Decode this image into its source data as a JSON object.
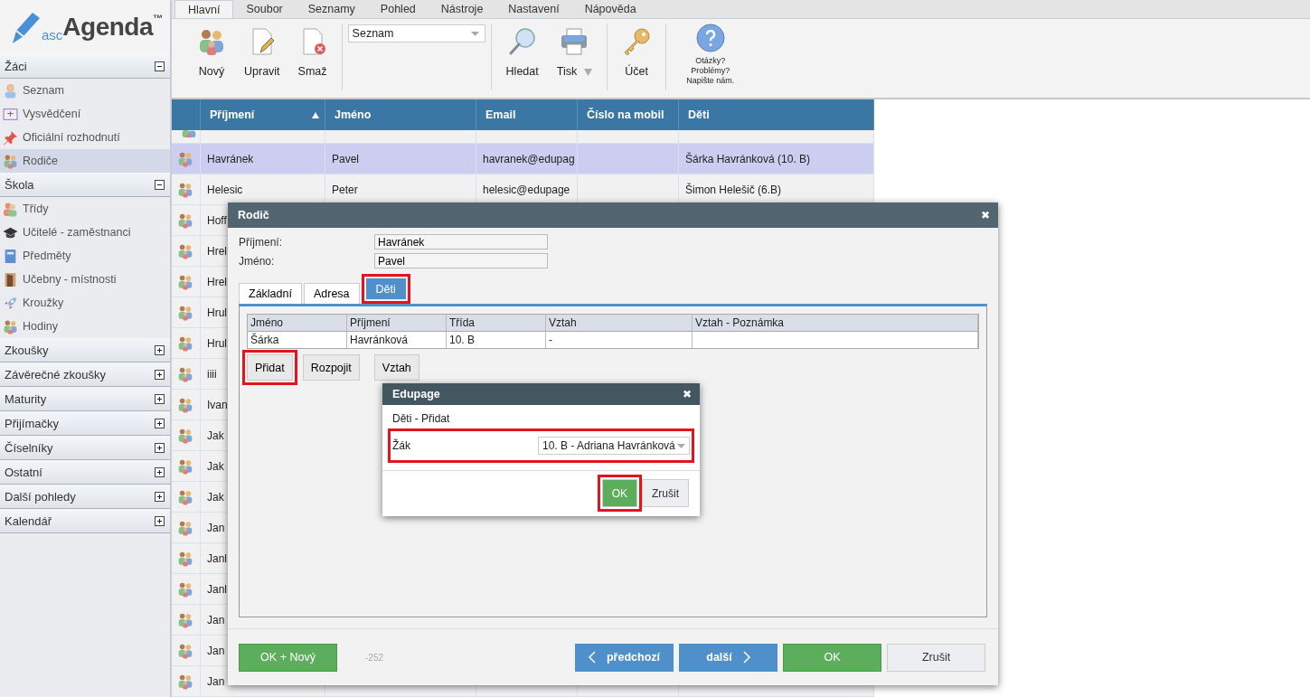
{
  "logo": {
    "prefix": "asc",
    "name": "Agenda",
    "mark": "™"
  },
  "menu_tabs": [
    {
      "label": "Hlavní",
      "selected": true
    },
    {
      "label": "Soubor",
      "selected": false
    },
    {
      "label": "Seznamy",
      "selected": false
    },
    {
      "label": "Pohled",
      "selected": false
    },
    {
      "label": "Nástroje",
      "selected": false
    },
    {
      "label": "Nastavení",
      "selected": false
    },
    {
      "label": "Nápověda",
      "selected": false
    }
  ],
  "ribbon": {
    "buttons_left": [
      {
        "label": "Nový",
        "kind": "people"
      },
      {
        "label": "Upravit",
        "kind": "edit"
      },
      {
        "label": "Smaž",
        "kind": "delete"
      }
    ],
    "view_select": {
      "value": "Seznam"
    },
    "buttons_right": [
      {
        "label": "Hledat",
        "kind": "search",
        "dropdown": false
      },
      {
        "label": "Tisk",
        "kind": "print",
        "dropdown": true
      }
    ],
    "account": {
      "label": "Účet",
      "kind": "key"
    },
    "help": {
      "lines": [
        "Otázky?",
        "Problémy?",
        "Napište nám."
      ]
    }
  },
  "sidebar": {
    "sections": [
      {
        "label": "Žáci",
        "expanded": true,
        "children": [
          {
            "label": "Seznam",
            "selected": false
          },
          {
            "label": "Vysvědčení",
            "selected": false
          },
          {
            "label": "Oficiální rozhodnutí",
            "selected": false
          },
          {
            "label": "Rodiče",
            "selected": true
          }
        ]
      },
      {
        "label": "Škola",
        "expanded": true,
        "children": [
          {
            "label": "Třídy",
            "selected": false
          },
          {
            "label": "Učitelé - zaměstnanci",
            "selected": false
          },
          {
            "label": "Předměty",
            "selected": false
          },
          {
            "label": "Učebny - místnosti",
            "selected": false
          },
          {
            "label": "Kroužky",
            "selected": false
          },
          {
            "label": "Hodiny",
            "selected": false
          }
        ]
      },
      {
        "label": "Zkoušky",
        "expanded": false
      },
      {
        "label": "Závěrečné zkoušky",
        "expanded": false
      },
      {
        "label": "Maturity",
        "expanded": false
      },
      {
        "label": "Přijímačky",
        "expanded": false
      },
      {
        "label": "Číselníky",
        "expanded": false
      },
      {
        "label": "Ostatní",
        "expanded": false
      },
      {
        "label": "Další pohledy",
        "expanded": false
      },
      {
        "label": "Kalendář",
        "expanded": false
      }
    ]
  },
  "table": {
    "columns": [
      {
        "label": "Příjmení",
        "sorted": true
      },
      {
        "label": "Jméno",
        "sorted": false
      },
      {
        "label": "Email",
        "sorted": false
      },
      {
        "label": "Číslo na mobil",
        "sorted": false
      },
      {
        "label": "Děti",
        "sorted": false
      }
    ],
    "rows": [
      {
        "kind": "cut",
        "selected": false
      },
      {
        "kind": "row",
        "selected": true,
        "cells": [
          "Havránek",
          "Pavel",
          "havranek@edupag",
          "",
          "Šárka Havránková (10. B)"
        ]
      },
      {
        "kind": "row",
        "selected": false,
        "cells": [
          "Helesic",
          "Peter",
          "helesic@edupage",
          "",
          "Šimon Helešič (6.B)"
        ]
      },
      {
        "kind": "row",
        "selected": false,
        "cells": [
          "Hoff"
        ]
      },
      {
        "kind": "row",
        "selected": false,
        "cells": [
          "Hrel"
        ]
      },
      {
        "kind": "row",
        "selected": false,
        "cells": [
          "Hrel"
        ]
      },
      {
        "kind": "row",
        "selected": false,
        "cells": [
          "Hrul"
        ]
      },
      {
        "kind": "row",
        "selected": false,
        "cells": [
          "Hrul"
        ]
      },
      {
        "kind": "row",
        "selected": false,
        "cells": [
          "iiii"
        ]
      },
      {
        "kind": "row",
        "selected": false,
        "cells": [
          "Ivan"
        ]
      },
      {
        "kind": "row",
        "selected": false,
        "cells": [
          "Jak"
        ]
      },
      {
        "kind": "row",
        "selected": false,
        "cells": [
          "Jak"
        ]
      },
      {
        "kind": "row",
        "selected": false,
        "cells": [
          "Jak"
        ]
      },
      {
        "kind": "row",
        "selected": false,
        "cells": [
          "Jan"
        ]
      },
      {
        "kind": "row",
        "selected": false,
        "cells": [
          "Janl"
        ]
      },
      {
        "kind": "row",
        "selected": false,
        "cells": [
          "Janl"
        ]
      },
      {
        "kind": "row",
        "selected": false,
        "cells": [
          "Jan"
        ]
      },
      {
        "kind": "row",
        "selected": false,
        "cells": [
          "Jan"
        ]
      },
      {
        "kind": "row",
        "selected": false,
        "cells": [
          "Jan"
        ]
      }
    ]
  },
  "parent_dialog": {
    "title": "Rodič",
    "close": "✖",
    "fields": [
      {
        "label": "Příjmení:",
        "value": "Havránek"
      },
      {
        "label": "Jméno:",
        "value": "Pavel"
      }
    ],
    "tabs": [
      {
        "label": "Základní",
        "selected": false,
        "highlighted": false
      },
      {
        "label": "Adresa",
        "selected": false,
        "highlighted": false
      },
      {
        "label": "Děti",
        "selected": true,
        "highlighted": true
      }
    ],
    "children_table": {
      "columns": [
        "Jméno",
        "Příjmení",
        "Třída",
        "Vztah",
        "Vztah - Poznámka"
      ],
      "rows": [
        [
          "Šárka",
          "Havránková",
          "10. B",
          "-",
          ""
        ]
      ]
    },
    "actions": [
      {
        "label": "Přidat",
        "highlighted": true
      },
      {
        "label": "Rozpojit",
        "highlighted": false
      },
      {
        "label": "Vztah",
        "highlighted": false
      }
    ],
    "footer": {
      "left_button": {
        "label": "OK + Nový",
        "kind": "confirm"
      },
      "record_id": "-252",
      "buttons": [
        {
          "label": "předchozí",
          "kind": "previous"
        },
        {
          "label": "další",
          "kind": "next"
        },
        {
          "label": "OK",
          "kind": "confirm"
        },
        {
          "label": "Zrušit",
          "kind": "cancel"
        }
      ]
    }
  },
  "add_dialog": {
    "title": "Edupage",
    "close": "✖",
    "subtitle": "Děti - Přidat",
    "field": {
      "label": "Žák",
      "value": "10. B - Adriana Havránková",
      "highlighted": true
    },
    "buttons": [
      {
        "label": "OK",
        "kind": "confirm",
        "highlighted": true
      },
      {
        "label": "Zrušit",
        "kind": "cancel",
        "highlighted": false
      }
    ]
  }
}
